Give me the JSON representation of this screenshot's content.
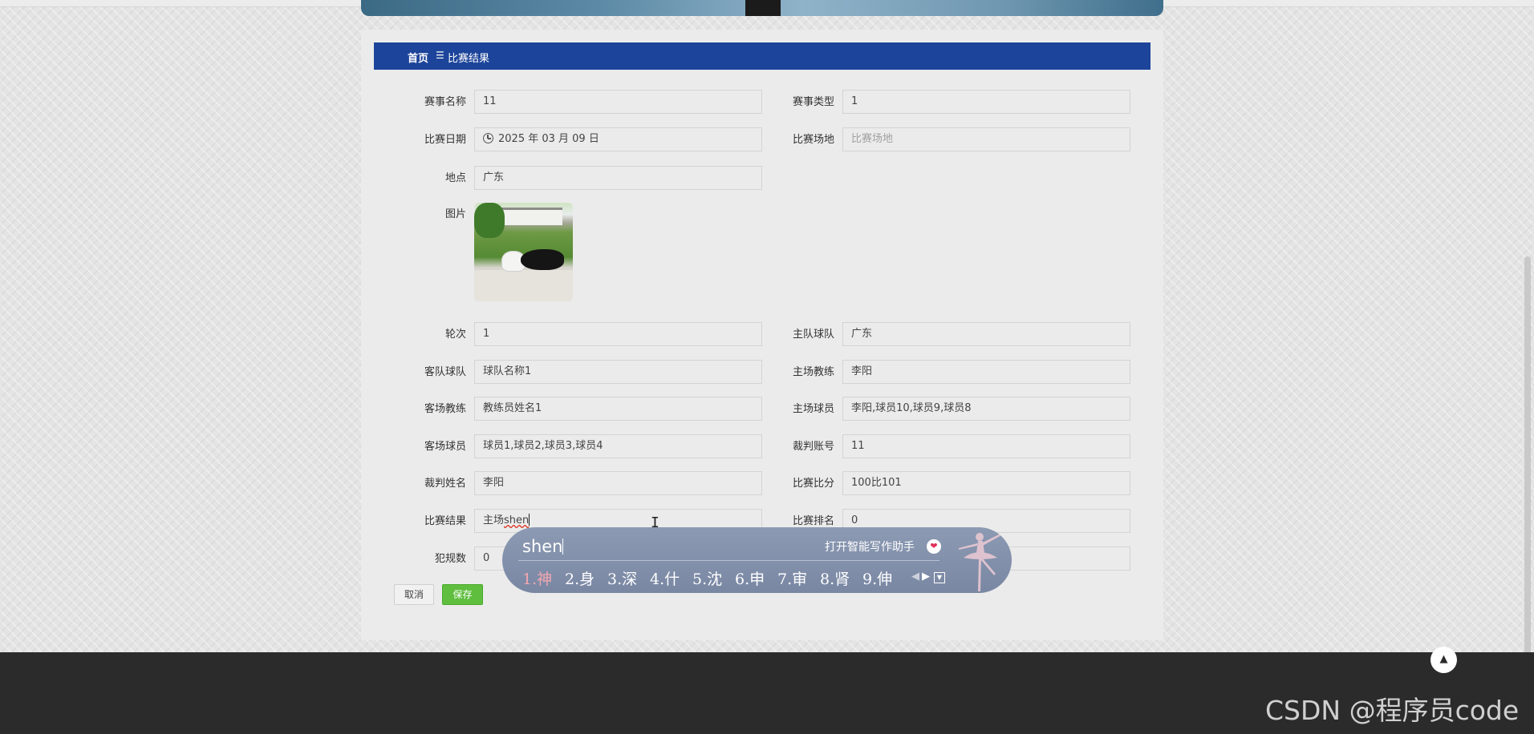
{
  "breadcrumb": {
    "home": "首页",
    "separator": "☰",
    "current": "比赛结果"
  },
  "form": {
    "event_name": {
      "label": "赛事名称",
      "value": "11"
    },
    "event_type": {
      "label": "赛事类型",
      "value": "1"
    },
    "match_date": {
      "label": "比赛日期",
      "value": "2025 年 03 月 09 日"
    },
    "venue": {
      "label": "比赛场地",
      "placeholder": "比赛场地"
    },
    "location": {
      "label": "地点",
      "value": "广东"
    },
    "picture": {
      "label": "图片"
    },
    "round": {
      "label": "轮次",
      "value": "1"
    },
    "home_team": {
      "label": "主队球队",
      "value": "广东"
    },
    "away_team": {
      "label": "客队球队",
      "value": "球队名称1"
    },
    "home_coach": {
      "label": "主场教练",
      "value": "李阳"
    },
    "away_coach": {
      "label": "客场教练",
      "value": "教练员姓名1"
    },
    "home_players": {
      "label": "主场球员",
      "value": "李阳,球员10,球员9,球员8"
    },
    "away_players": {
      "label": "客场球员",
      "value": "球员1,球员2,球员3,球员4"
    },
    "referee_account": {
      "label": "裁判账号",
      "value": "11"
    },
    "referee_name": {
      "label": "裁判姓名",
      "value": "李阳"
    },
    "score": {
      "label": "比赛比分",
      "value": "100比101"
    },
    "result": {
      "label": "比赛结果",
      "value_prefix": "主场",
      "value_typed": "shen"
    },
    "ranking": {
      "label": "比赛排名",
      "value": "0"
    },
    "fouls": {
      "label": "犯规数",
      "value": "0"
    }
  },
  "buttons": {
    "cancel": "取消",
    "save": "保存"
  },
  "ime": {
    "pinyin": "shen",
    "assistant": "打开智能写作助手",
    "candidates": [
      "1.神",
      "2.身",
      "3.深",
      "4.什",
      "5.沈",
      "6.申",
      "7.审",
      "8.肾",
      "9.伸"
    ],
    "prev_arrow": "◀",
    "next_arrow": "▶",
    "dropdown": "▼"
  },
  "back_to_top": "▲",
  "watermark": "CSDN @程序员code",
  "colors": {
    "header": "#1c449a",
    "save_button": "#5fbe3e",
    "footer": "#2b2b2b",
    "ime_panel": "#8290ab"
  }
}
